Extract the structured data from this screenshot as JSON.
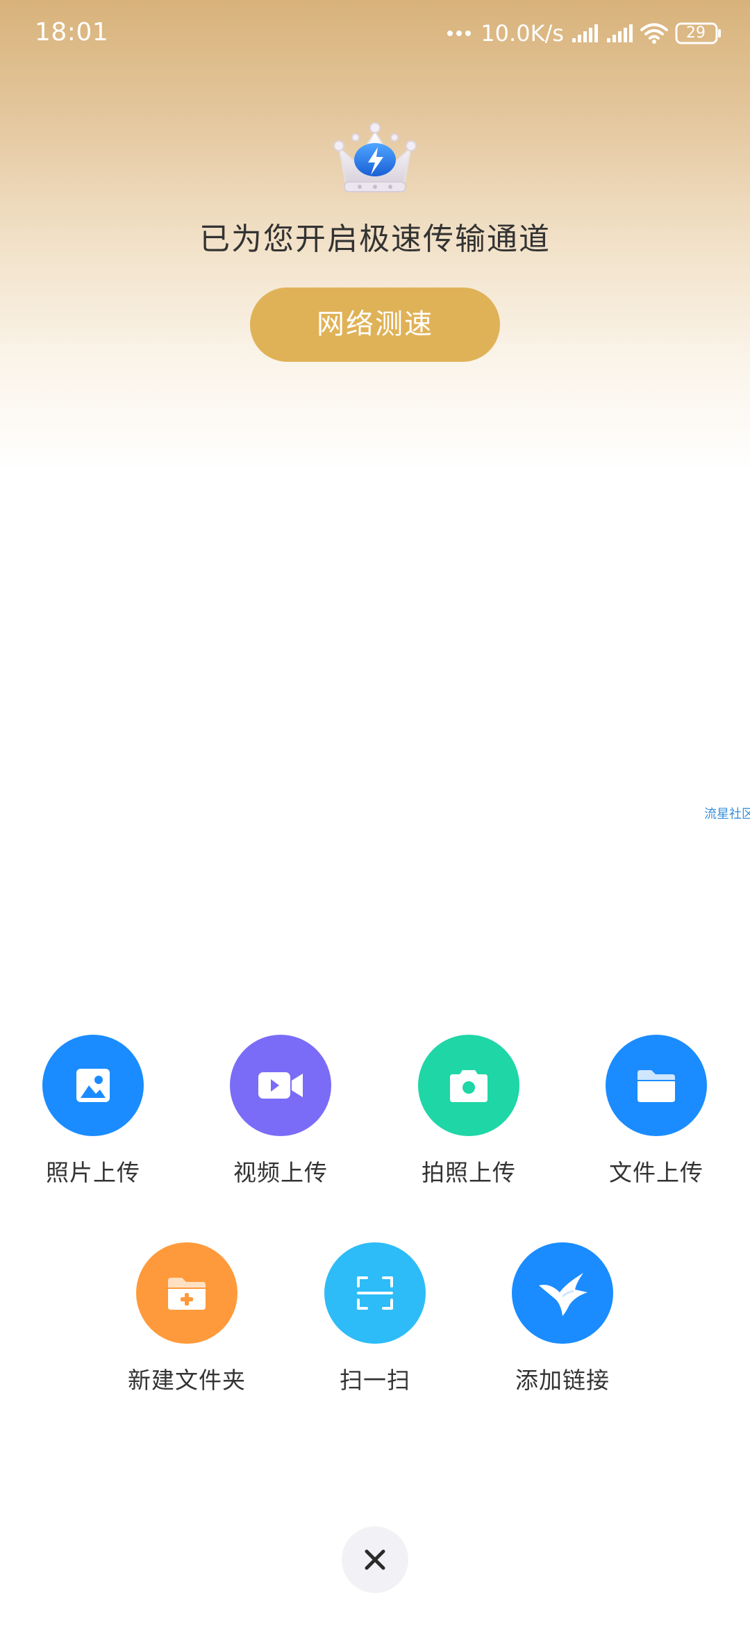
{
  "status_bar": {
    "time": "18:01",
    "net_speed": "10.0K/s",
    "battery": "29"
  },
  "banner": {
    "icon": "crown-icon",
    "headline": "已为您开启极速传输通道",
    "button_label": "网络测速",
    "accent_color": "#e0b257"
  },
  "watermark": "流星社区",
  "actions": [
    {
      "label": "照片上传",
      "icon": "photo-icon",
      "color": "#1a8cff"
    },
    {
      "label": "视频上传",
      "icon": "video-icon",
      "color": "#7a6cf7"
    },
    {
      "label": "拍照上传",
      "icon": "camera-icon",
      "color": "#1fd6a6"
    },
    {
      "label": "文件上传",
      "icon": "folder-icon",
      "color": "#1a8cff"
    },
    {
      "label": "新建文件夹",
      "icon": "new-folder-icon",
      "color": "#ff9a3c"
    },
    {
      "label": "扫一扫",
      "icon": "scan-icon",
      "color": "#2dbcf7"
    },
    {
      "label": "添加链接",
      "icon": "bird-link-icon",
      "color": "#1a8cff"
    }
  ],
  "close": {
    "icon": "close-icon"
  }
}
